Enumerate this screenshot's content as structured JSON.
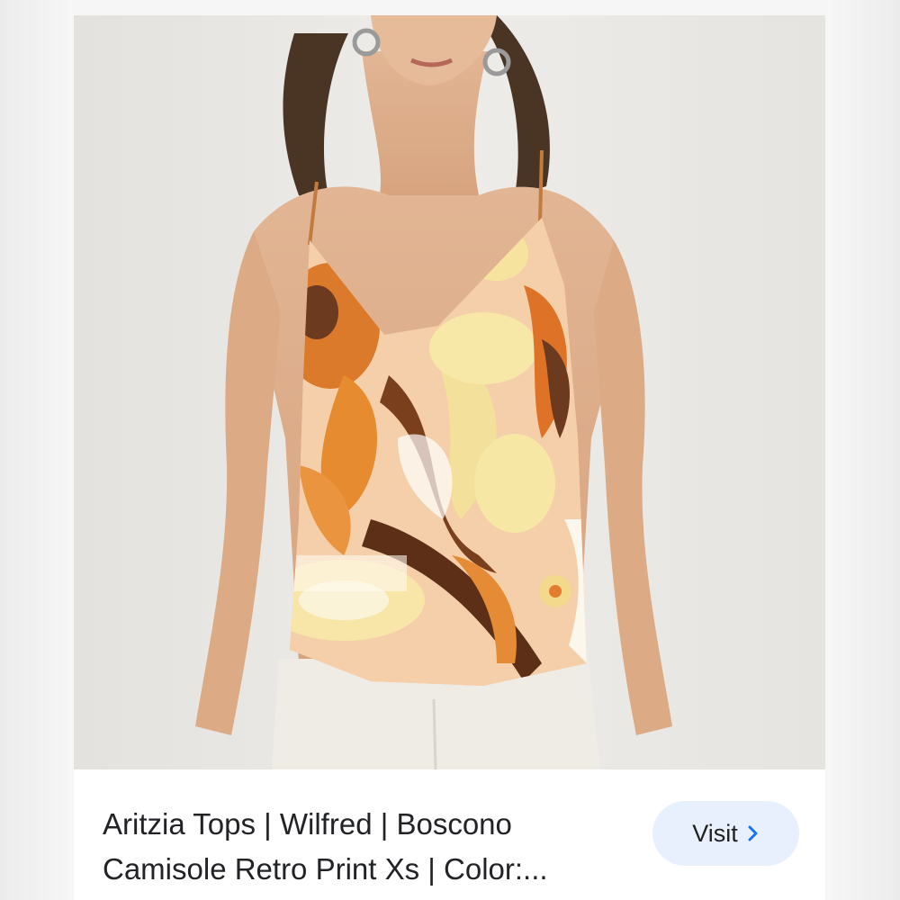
{
  "product": {
    "title": "Aritzia Tops | Wilfred | Boscono Camisole Retro Print Xs | Color:..."
  },
  "actions": {
    "visit_label": "Visit"
  },
  "icons": {
    "visit_arrow": "chevron-right-icon"
  },
  "colors": {
    "visit_button_bg": "#e8f0fe",
    "chevron": "#1a73e8",
    "title_text": "#222326"
  }
}
